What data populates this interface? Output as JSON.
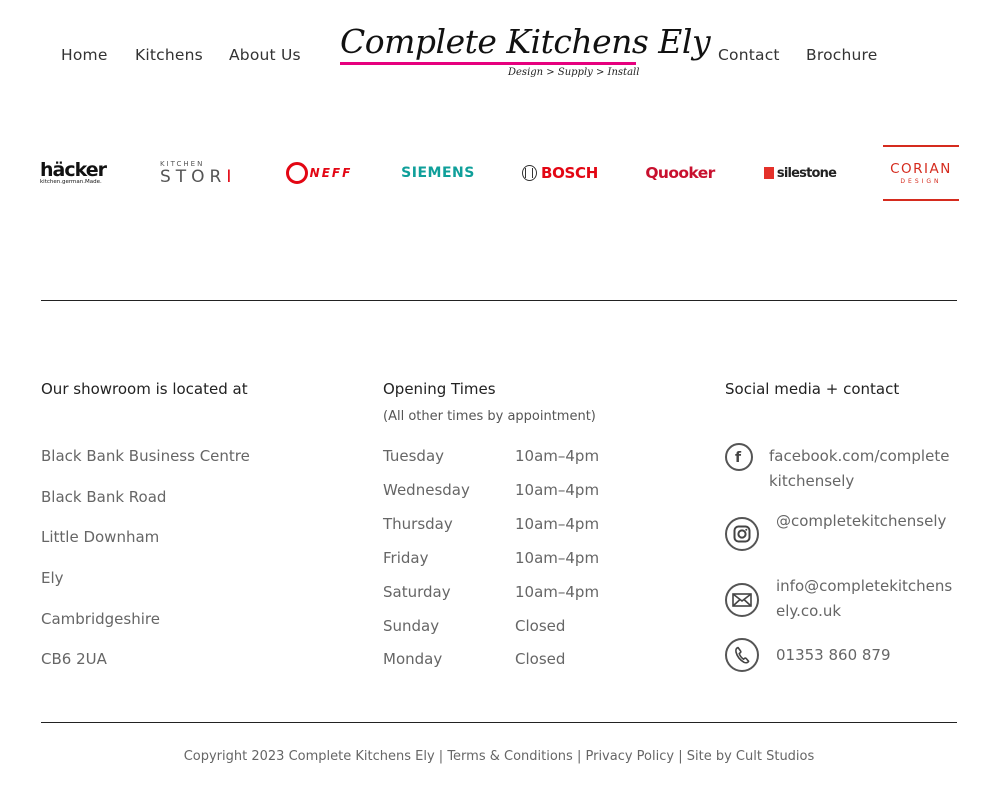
{
  "nav": {
    "home": "Home",
    "kitchens": "Kitchens",
    "about": "About Us",
    "contact": "Contact",
    "brochure": "Brochure"
  },
  "logo": {
    "title": "Complete Kitchens Ely",
    "tagline": "Design > Supply > Install"
  },
  "brands": {
    "hacker": {
      "name": "häcker",
      "sub": "kitchen.german.Made."
    },
    "stori": {
      "small": "KITCHEN",
      "big": "STOR",
      "accent": "I"
    },
    "neff": "NEFF",
    "siemens": "SIEMENS",
    "bosch": "BOSCH",
    "quooker": "Quooker",
    "silestone": "silestone",
    "corian": {
      "name": "CORIAN",
      "sub": "DESIGN"
    }
  },
  "showroom": {
    "title": "Our showroom is located at",
    "address": [
      "Black Bank Business Centre",
      "Black Bank Road",
      "Little Downham",
      "Ely",
      "Cambridgeshire",
      "CB6 2UA"
    ]
  },
  "opening": {
    "title": "Opening Times",
    "subtitle": "(All other times by appointment)",
    "days": [
      {
        "day": "Tuesday",
        "time": "10am–4pm"
      },
      {
        "day": "Wednesday",
        "time": "10am–4pm"
      },
      {
        "day": "Thursday",
        "time": "10am–4pm"
      },
      {
        "day": "Friday",
        "time": "10am–4pm"
      },
      {
        "day": "Saturday",
        "time": "10am–4pm"
      },
      {
        "day": "Sunday",
        "time": "Closed"
      },
      {
        "day": "Monday",
        "time": "Closed"
      }
    ]
  },
  "social": {
    "title": "Social media + contact",
    "facebook": "facebook.com/completekitchensely",
    "instagram": "@completekitchensely",
    "email": "info@completekitchensely.co.uk",
    "phone": "01353 860 879"
  },
  "footer": {
    "copyright": "Copyright 2023 Complete Kitchens Ely",
    "sep": "|",
    "terms": "Terms & Conditions",
    "privacy": "Privacy Policy",
    "credit": "Site by Cult Studios"
  },
  "colors": {
    "accent": "#e6007e",
    "text": "#666666",
    "heading": "#222222"
  }
}
